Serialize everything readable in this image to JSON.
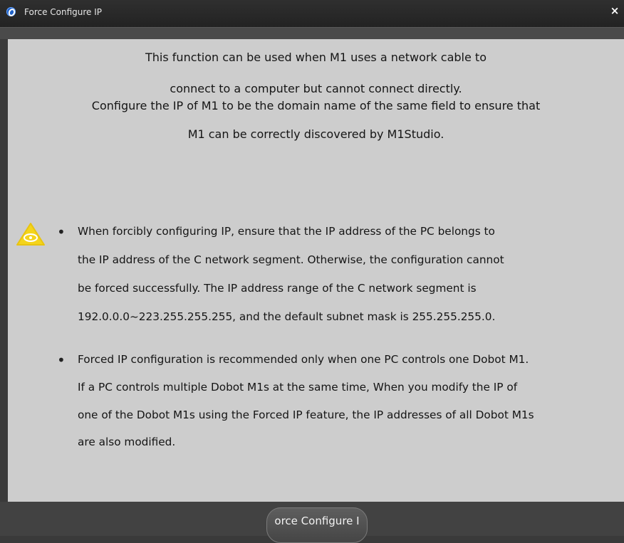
{
  "window": {
    "title": "Force Configure IP",
    "close_glyph": "×"
  },
  "intro": {
    "line1": "This function can be used when M1 uses a network cable to",
    "line2": "connect to a computer but cannot connect directly.",
    "line3": "Configure the IP of M1 to be the domain name of the same field to ensure that",
    "line4": "M1 can be correctly discovered by M1Studio."
  },
  "notes": {
    "bullet_glyph": "•",
    "note1": [
      "When forcibly configuring IP, ensure that the IP address of the PC belongs to",
      "the IP address of the C network segment. Otherwise, the configuration cannot",
      "be forced successfully. The IP address range of the C network segment is",
      "192.0.0.0~223.255.255.255, and the default subnet mask is 255.255.255.0."
    ],
    "note2": [
      "Forced IP configuration is recommended only when one PC controls one Dobot M1.",
      "If a PC controls multiple Dobot M1s at the same time, When you modify the IP of",
      "one of the Dobot M1s using the Forced IP feature, the IP addresses of all Dobot M1s",
      "are also modified."
    ]
  },
  "footer": {
    "button_label": "orce Configure I"
  },
  "colors": {
    "panel_bg": "#cdcdcd",
    "titlebar_bg": "#2a2a2a",
    "warning_yellow": "#f4d41c"
  },
  "icons": {
    "app": "app-logo-icon",
    "close": "close-icon",
    "warning": "warning-icon"
  }
}
